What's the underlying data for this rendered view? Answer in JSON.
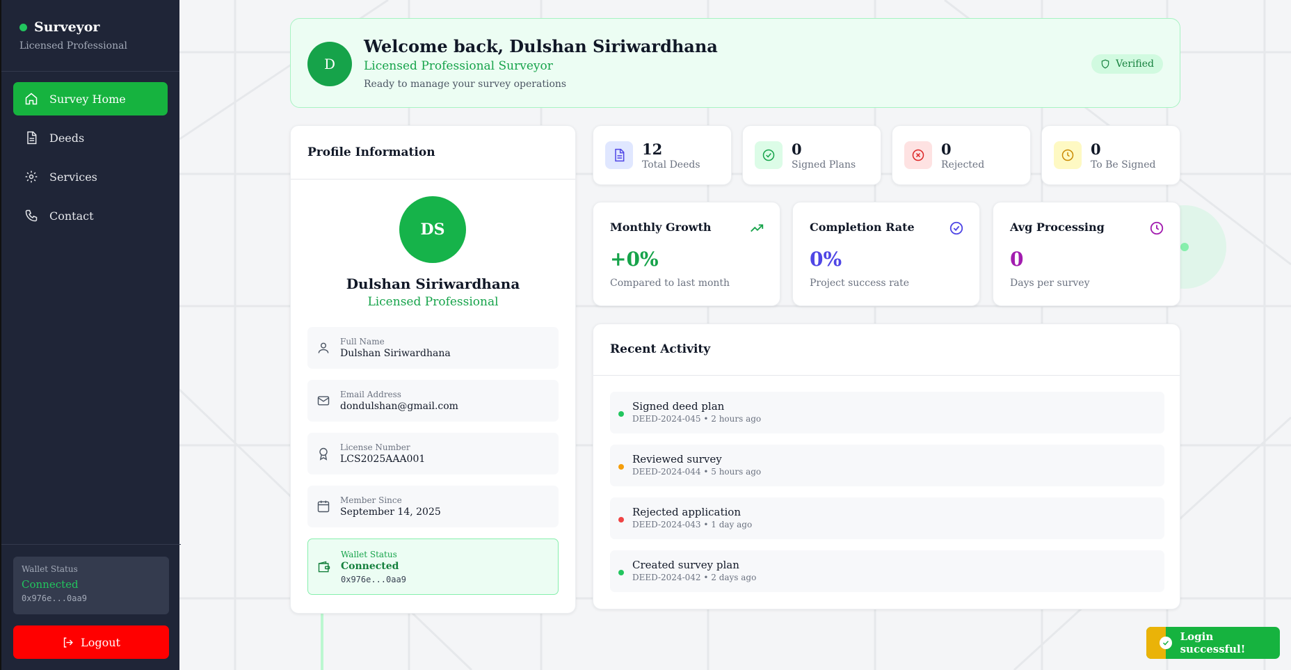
{
  "sidebar": {
    "brand_title": "Surveyor",
    "brand_subtitle": "Licensed Professional",
    "items": [
      {
        "label": "Survey Home",
        "icon": "home-icon"
      },
      {
        "label": "Deeds",
        "icon": "document-icon"
      },
      {
        "label": "Services",
        "icon": "gear-icon"
      },
      {
        "label": "Contact",
        "icon": "phone-icon"
      }
    ],
    "wallet_label": "Wallet Status",
    "wallet_status": "Connected",
    "wallet_address": "0x976e...0aa9",
    "logout_label": "Logout"
  },
  "welcome": {
    "avatar_initial": "D",
    "title": "Welcome back, Dulshan Siriwardhana",
    "role": "Licensed Professional Surveyor",
    "description": "Ready to manage your survey operations",
    "badge": "Verified"
  },
  "profile": {
    "heading": "Profile Information",
    "avatar_initials": "DS",
    "name": "Dulshan Siriwardhana",
    "role": "Licensed Professional",
    "fields": [
      {
        "label": "Full Name",
        "value": "Dulshan Siriwardhana"
      },
      {
        "label": "Email Address",
        "value": "dondulshan@gmail.com"
      },
      {
        "label": "License Number",
        "value": "LCS2025AAA001"
      },
      {
        "label": "Member Since",
        "value": "September 14, 2025"
      }
    ],
    "wallet": {
      "label": "Wallet Status",
      "value": "Connected",
      "address": "0x976e...0aa9"
    }
  },
  "stats": [
    {
      "value": "12",
      "label": "Total Deeds",
      "color": "#4f46e5"
    },
    {
      "value": "0",
      "label": "Signed Plans",
      "color": "#16a34a"
    },
    {
      "value": "0",
      "label": "Rejected",
      "color": "#dc2626"
    },
    {
      "value": "0",
      "label": "To Be Signed",
      "color": "#ca8a04"
    }
  ],
  "metrics": [
    {
      "title": "Monthly Growth",
      "value": "+0%",
      "sub": "Compared to last month",
      "color": "#16a34a"
    },
    {
      "title": "Completion Rate",
      "value": "0%",
      "sub": "Project success rate",
      "color": "#4f46e5"
    },
    {
      "title": "Avg Processing",
      "value": "0",
      "sub": "Days per survey",
      "color": "#a21caf"
    }
  ],
  "activity": {
    "heading": "Recent Activity",
    "items": [
      {
        "title": "Signed deed plan",
        "meta": "DEED-2024-045 • 2 hours ago",
        "color": "#22c55e"
      },
      {
        "title": "Reviewed survey",
        "meta": "DEED-2024-044 • 5 hours ago",
        "color": "#f59e0b"
      },
      {
        "title": "Rejected application",
        "meta": "DEED-2024-043 • 1 day ago",
        "color": "#ef4444"
      },
      {
        "title": "Created survey plan",
        "meta": "DEED-2024-042 • 2 days ago",
        "color": "#22c55e"
      }
    ]
  },
  "toast": {
    "message": "Login successful!"
  }
}
